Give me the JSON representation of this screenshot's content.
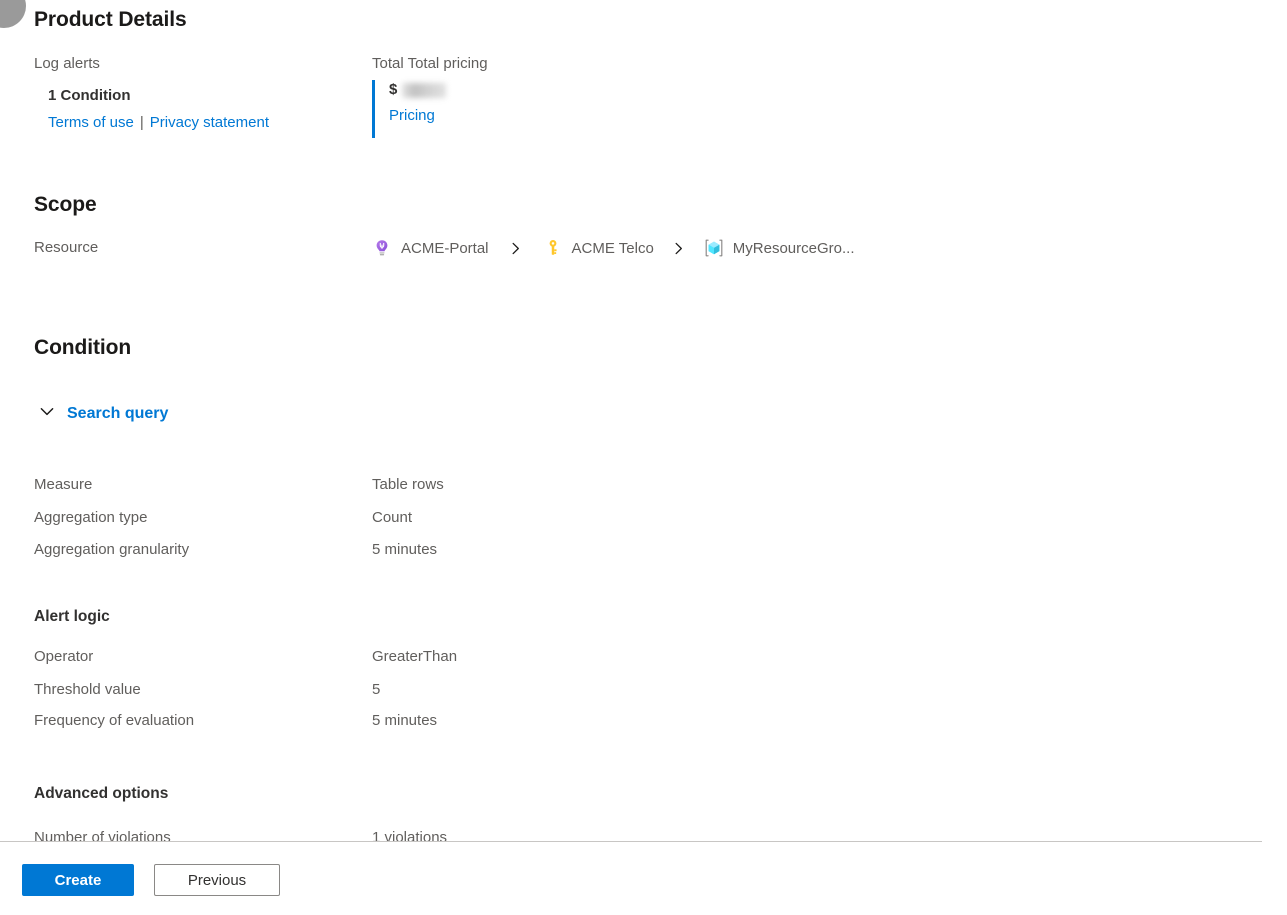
{
  "product_details": {
    "heading": "Product Details",
    "alert_type_label": "Log alerts",
    "condition_count": "1 Condition",
    "terms_link": "Terms of use",
    "link_separator": "|",
    "privacy_link": "Privacy statement",
    "pricing_heading": "Total Total pricing",
    "currency_symbol": "$",
    "pricing_link": "Pricing"
  },
  "scope": {
    "heading": "Scope",
    "resource_label": "Resource",
    "breadcrumb": [
      {
        "label": "ACME-Portal",
        "icon": "lightbulb-icon"
      },
      {
        "label": "ACME Telco",
        "icon": "key-icon"
      },
      {
        "label": "MyResourceGro...",
        "icon": "resource-group-icon"
      }
    ],
    "separator_icon": "chevron-right-icon"
  },
  "condition": {
    "heading": "Condition",
    "search_query_label": "Search query",
    "search_query_icon": "chevron-down-icon",
    "rows": [
      {
        "label": "Measure",
        "value": "Table rows"
      },
      {
        "label": "Aggregation type",
        "value": "Count"
      },
      {
        "label": "Aggregation granularity",
        "value": "5 minutes"
      }
    ]
  },
  "alert_logic": {
    "heading": "Alert logic",
    "rows": [
      {
        "label": "Operator",
        "value": "GreaterThan"
      },
      {
        "label": "Threshold value",
        "value": "5"
      },
      {
        "label": "Frequency of evaluation",
        "value": "5 minutes"
      }
    ]
  },
  "advanced_options": {
    "heading": "Advanced options",
    "rows": [
      {
        "label": "Number of violations",
        "value": "1 violations"
      }
    ]
  },
  "footer": {
    "create_label": "Create",
    "previous_label": "Previous"
  },
  "colors": {
    "accent": "#0078d4",
    "link": "#0078d4",
    "text_primary": "#323130",
    "text_secondary": "#605e5c",
    "divider": "#c8c6c4"
  }
}
